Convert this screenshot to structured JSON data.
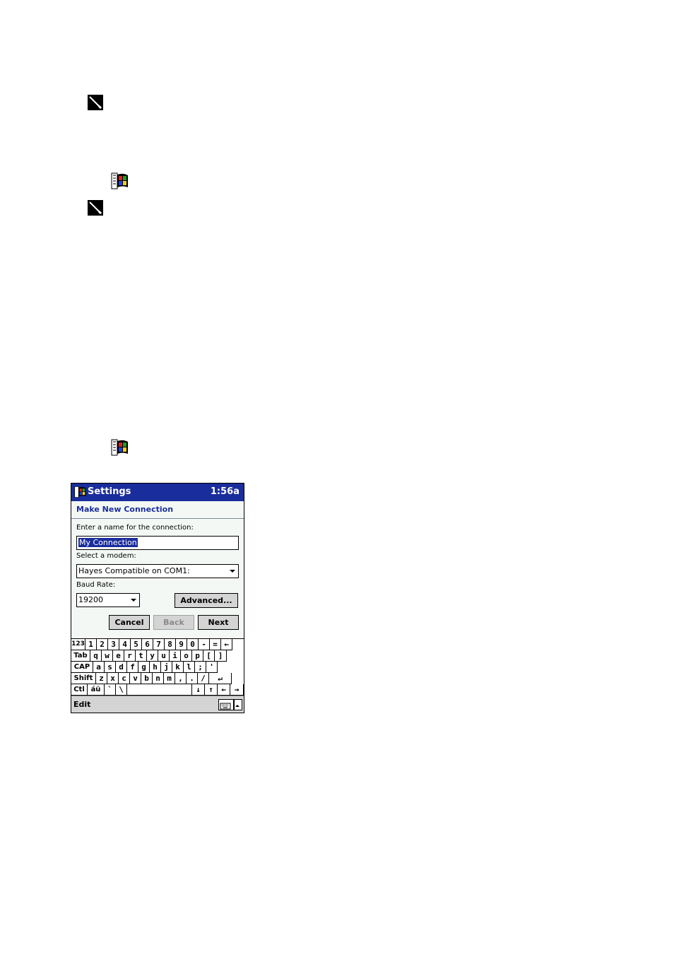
{
  "app": {
    "title": "Settings",
    "clock": "1:56a"
  },
  "page": {
    "heading": "Make New Connection"
  },
  "form": {
    "name_label": "Enter a name for the connection:",
    "name_value": "My Connection",
    "modem_label": "Select a modem:",
    "modem_value": "Hayes Compatible on COM1:",
    "baud_label": "Baud Rate:",
    "baud_value": "19200",
    "advanced_label": "Advanced...",
    "cancel_label": "Cancel",
    "back_label": "Back",
    "next_label": "Next"
  },
  "keyboard": {
    "rows": [
      [
        "123",
        "1",
        "2",
        "3",
        "4",
        "5",
        "6",
        "7",
        "8",
        "9",
        "0",
        "-",
        "=",
        "←"
      ],
      [
        "Tab",
        "q",
        "w",
        "e",
        "r",
        "t",
        "y",
        "u",
        "i",
        "o",
        "p",
        "[",
        "]"
      ],
      [
        "CAP",
        "a",
        "s",
        "d",
        "f",
        "g",
        "h",
        "j",
        "k",
        "l",
        ";",
        "'"
      ],
      [
        "Shift",
        "z",
        "x",
        "c",
        "v",
        "b",
        "n",
        "m",
        ",",
        ".",
        "/",
        "↵"
      ],
      [
        "Ctl",
        "áü",
        "`",
        "\\",
        " ",
        "↓",
        "↑",
        "←",
        "→"
      ]
    ]
  },
  "menubar": {
    "edit_label": "Edit"
  },
  "icons": {
    "stylus": "stylus-icon",
    "start": "windows-flag-icon",
    "keyboard": "keyboard-icon",
    "sip_up": "chevron-up-icon"
  }
}
